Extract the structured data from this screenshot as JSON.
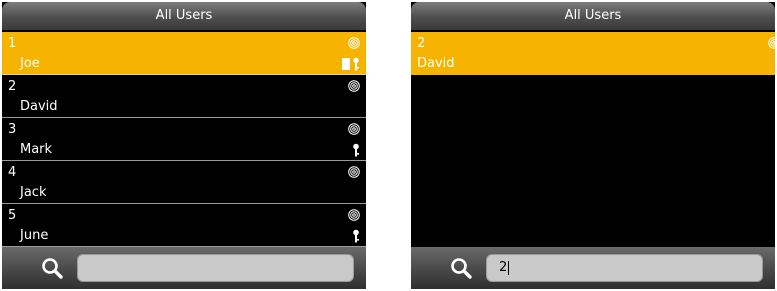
{
  "left_screen": {
    "title": "All Users",
    "users": [
      {
        "number": "1",
        "name": "Joe",
        "fingerprint": true,
        "card": true,
        "key": true,
        "selected": true
      },
      {
        "number": "2",
        "name": "David",
        "fingerprint": true,
        "card": false,
        "key": false,
        "selected": false
      },
      {
        "number": "3",
        "name": "Mark",
        "fingerprint": true,
        "card": false,
        "key": true,
        "selected": false
      },
      {
        "number": "4",
        "name": "Jack",
        "fingerprint": true,
        "card": false,
        "key": false,
        "selected": false
      },
      {
        "number": "5",
        "name": "June",
        "fingerprint": true,
        "card": false,
        "key": true,
        "selected": false
      }
    ],
    "search": {
      "value": "",
      "icon": "search-icon"
    }
  },
  "right_screen": {
    "title": "All Users",
    "users": [
      {
        "number": "2",
        "name": "David",
        "fingerprint": true,
        "card": false,
        "key": false,
        "selected": true
      }
    ],
    "search": {
      "value": "2",
      "icon": "search-icon"
    }
  },
  "colors": {
    "selected_row": "#f6b400",
    "screen_bg": "#000000",
    "text": "#ffffff"
  },
  "icons": {
    "fingerprint": "fingerprint-icon",
    "card": "card-icon",
    "password": "key-icon"
  }
}
